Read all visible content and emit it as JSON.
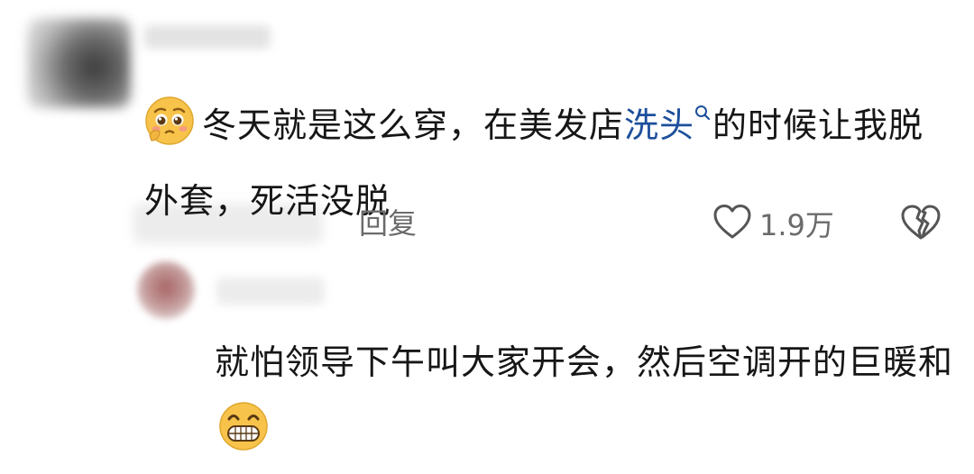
{
  "comment": {
    "text_before": "冬天就是这么穿，在美发店",
    "search_link": "洗头",
    "text_after": "的时候让我脱外套，死活没脱",
    "reply_label": "回复",
    "like_count": "1.9万",
    "icons": [
      "pleading-face-emoji",
      "search-icon",
      "heart-icon",
      "broken-heart-icon"
    ]
  },
  "reply": {
    "text": "就怕领导下午叫大家开会，然后空调开的巨暖和",
    "icons": [
      "grinning-face-emoji"
    ]
  },
  "colors": {
    "link": "#1d4f9b",
    "secondary_text": "#6b6b6b",
    "text": "#161616"
  }
}
